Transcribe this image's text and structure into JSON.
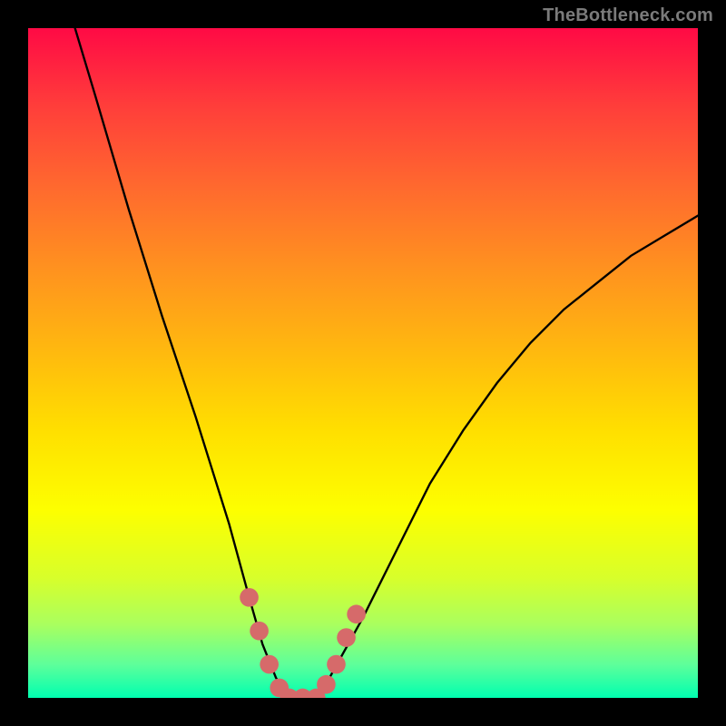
{
  "watermark": "TheBottleneck.com",
  "chart_data": {
    "type": "line",
    "title": "",
    "xlabel": "",
    "ylabel": "",
    "xlim": [
      0,
      100
    ],
    "ylim": [
      0,
      100
    ],
    "grid": false,
    "series": [
      {
        "name": "bottleneck-curve",
        "x": [
          7,
          10,
          15,
          20,
          25,
          30,
          33,
          35,
          37,
          39,
          41,
          43,
          45,
          50,
          55,
          60,
          65,
          70,
          75,
          80,
          85,
          90,
          95,
          100
        ],
        "y": [
          100,
          90,
          73,
          57,
          42,
          26,
          15,
          8,
          3,
          0,
          0,
          0,
          3,
          12,
          22,
          32,
          40,
          47,
          53,
          58,
          62,
          66,
          69,
          72
        ]
      }
    ],
    "marker_zone": {
      "name": "optimal-range-markers",
      "color": "#d66a6a",
      "points": [
        {
          "x": 33,
          "y": 15
        },
        {
          "x": 34.5,
          "y": 10
        },
        {
          "x": 36,
          "y": 5
        },
        {
          "x": 37.5,
          "y": 1.5
        },
        {
          "x": 39,
          "y": 0
        },
        {
          "x": 41,
          "y": 0
        },
        {
          "x": 43,
          "y": 0
        },
        {
          "x": 44.5,
          "y": 2
        },
        {
          "x": 46,
          "y": 5
        },
        {
          "x": 47.5,
          "y": 9
        },
        {
          "x": 49,
          "y": 12.5
        }
      ]
    },
    "background_gradient": {
      "top": "#ff0a45",
      "mid": "#ffdf00",
      "bottom": "#00ffb0"
    }
  }
}
